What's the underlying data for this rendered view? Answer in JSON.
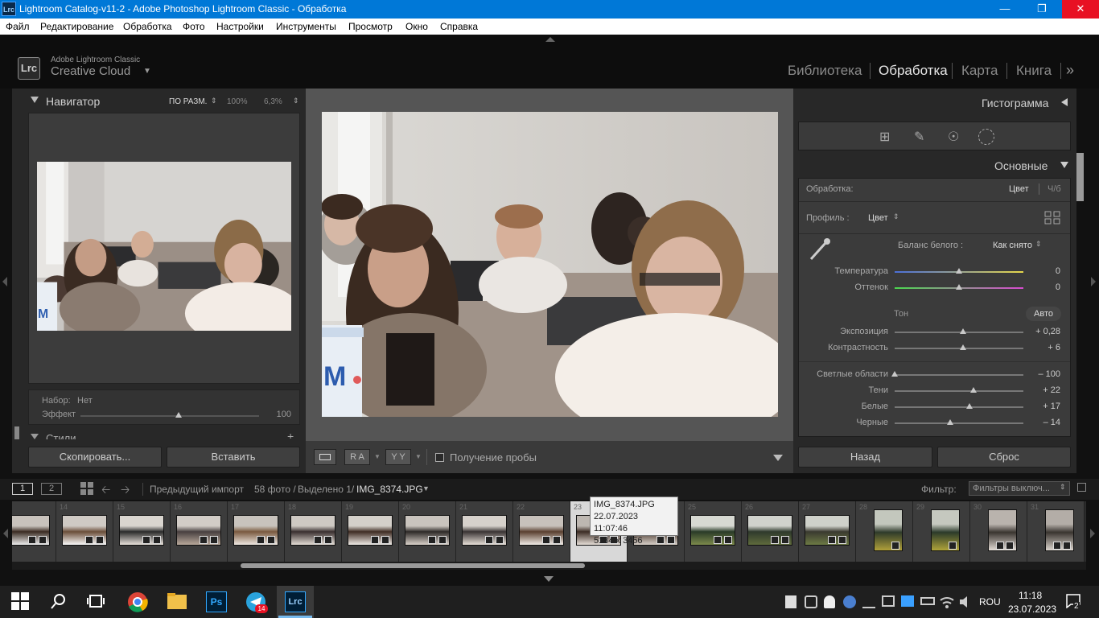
{
  "window": {
    "title": "Lightroom Catalog-v11-2 - Adobe Photoshop Lightroom Classic - Обработка",
    "app_icon": "Lrc",
    "controls": [
      "minimize-icon",
      "maximize-icon",
      "close-icon"
    ]
  },
  "menu": [
    "Файл",
    "Редактирование",
    "Обработка",
    "Фото",
    "Настройки",
    "Инструменты",
    "Просмотр",
    "Окно",
    "Справка"
  ],
  "brand": {
    "logo": "Lrc",
    "line1": "Adobe Lightroom Classic",
    "line2": "Creative Cloud"
  },
  "modules": [
    "Библиотека",
    "Обработка",
    "Карта",
    "Книга"
  ],
  "navigator": {
    "title": "Навигатор",
    "zoom_options": [
      "ПО РАЗМ.",
      "100%",
      "6,3%"
    ]
  },
  "presets": {
    "set_label": "Набор:",
    "set_value": "Нет",
    "effect_label": "Эффект",
    "effect_value": "100",
    "effect_level": 0.55,
    "styles_label": "Стили"
  },
  "left_buttons": {
    "copy": "Скопировать...",
    "paste": "Вставить"
  },
  "toolbar": {
    "soft_proofing": "Получение пробы",
    "ra_label": "R A",
    "yy_label": "Y Y"
  },
  "right": {
    "histogram_title": "Гистограмма",
    "basic_title": "Основные",
    "treatment_label": "Обработка:",
    "treatment_color": "Цвет",
    "treatment_bw": "Ч/б",
    "profile_label": "Профиль :",
    "profile_value": "Цвет",
    "wb_label": "Баланс белого :",
    "wb_value": "Как снято",
    "tone_label": "Тон",
    "auto_label": "Авто",
    "sliders": [
      {
        "label": "Температура",
        "value": "0",
        "level": 0.5
      },
      {
        "label": "Оттенок",
        "value": "0",
        "level": 0.5
      },
      {
        "label": "Экспозиция",
        "value": "+ 0,28",
        "level": 0.53
      },
      {
        "label": "Контрастность",
        "value": "+ 6",
        "level": 0.53
      },
      {
        "label": "Светлые области",
        "value": "– 100",
        "level": 0.0
      },
      {
        "label": "Тени",
        "value": "+ 22",
        "level": 0.61
      },
      {
        "label": "Белые",
        "value": "+ 17",
        "level": 0.58
      },
      {
        "label": "Черные",
        "value": "– 14",
        "level": 0.43
      }
    ],
    "back_button": "Назад",
    "reset_button": "Сброс"
  },
  "filmstrip_bar": {
    "screen1": "1",
    "screen2": "2",
    "source": "Предыдущий импорт",
    "count": "58 фото /",
    "selected": "Выделено 1/",
    "filename": "IMG_8374.JPG",
    "filter_label": "Фильтр:",
    "filter_value": "Фильтры выключ..."
  },
  "filmstrip_numbers": [
    "",
    "14",
    "15",
    "16",
    "17",
    "18",
    "19",
    "20",
    "21",
    "22",
    "23",
    "24",
    "25",
    "26",
    "27",
    "28",
    "29",
    "30",
    "31"
  ],
  "tooltip": {
    "line1": "IMG_8374.JPG",
    "line2": "22.07.2023 11:07:46",
    "line3": "5184 x 3456"
  },
  "taskbar": {
    "apps": [
      "windows-start-icon",
      "search-icon",
      "task-view-icon",
      "chrome-icon",
      "file-explorer-icon",
      "photoshop-icon",
      "telegram-icon",
      "lightroom-icon"
    ],
    "ps_label": "Ps",
    "lrc_label": "Lrc",
    "telegram_badge": "14",
    "lang": "ROU",
    "time": "11:18",
    "date": "23.07.2023",
    "notifications": "2"
  }
}
